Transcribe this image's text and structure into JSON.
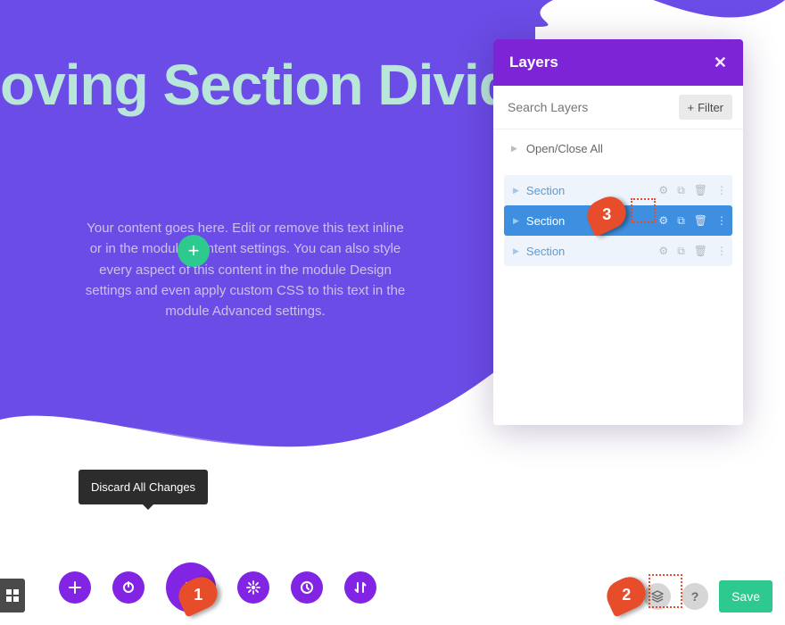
{
  "hero": {
    "title": "oving Section Divide",
    "body": "Your content goes here. Edit or remove this text inline or in the module Content settings. You can also style every aspect of this content in the module Design settings and even apply custom CSS to this text in the module Advanced settings."
  },
  "layers": {
    "title": "Layers",
    "search_placeholder": "Search Layers",
    "filter_label": "Filter",
    "open_all_label": "Open/Close All",
    "items": [
      {
        "label": "Section",
        "active": false
      },
      {
        "label": "Section",
        "active": true
      },
      {
        "label": "Section",
        "active": false
      }
    ]
  },
  "tooltip": {
    "text": "Discard All Changes"
  },
  "bottom": {
    "save_label": "Save"
  },
  "callouts": {
    "c1": "1",
    "c2": "2",
    "c3": "3"
  },
  "colors": {
    "brand_purple": "#8224e3",
    "hero_purple": "#6b4ce6",
    "accent_green": "#2dc98f",
    "callout_red": "#e74c2b",
    "link_blue": "#5b9bd8"
  }
}
